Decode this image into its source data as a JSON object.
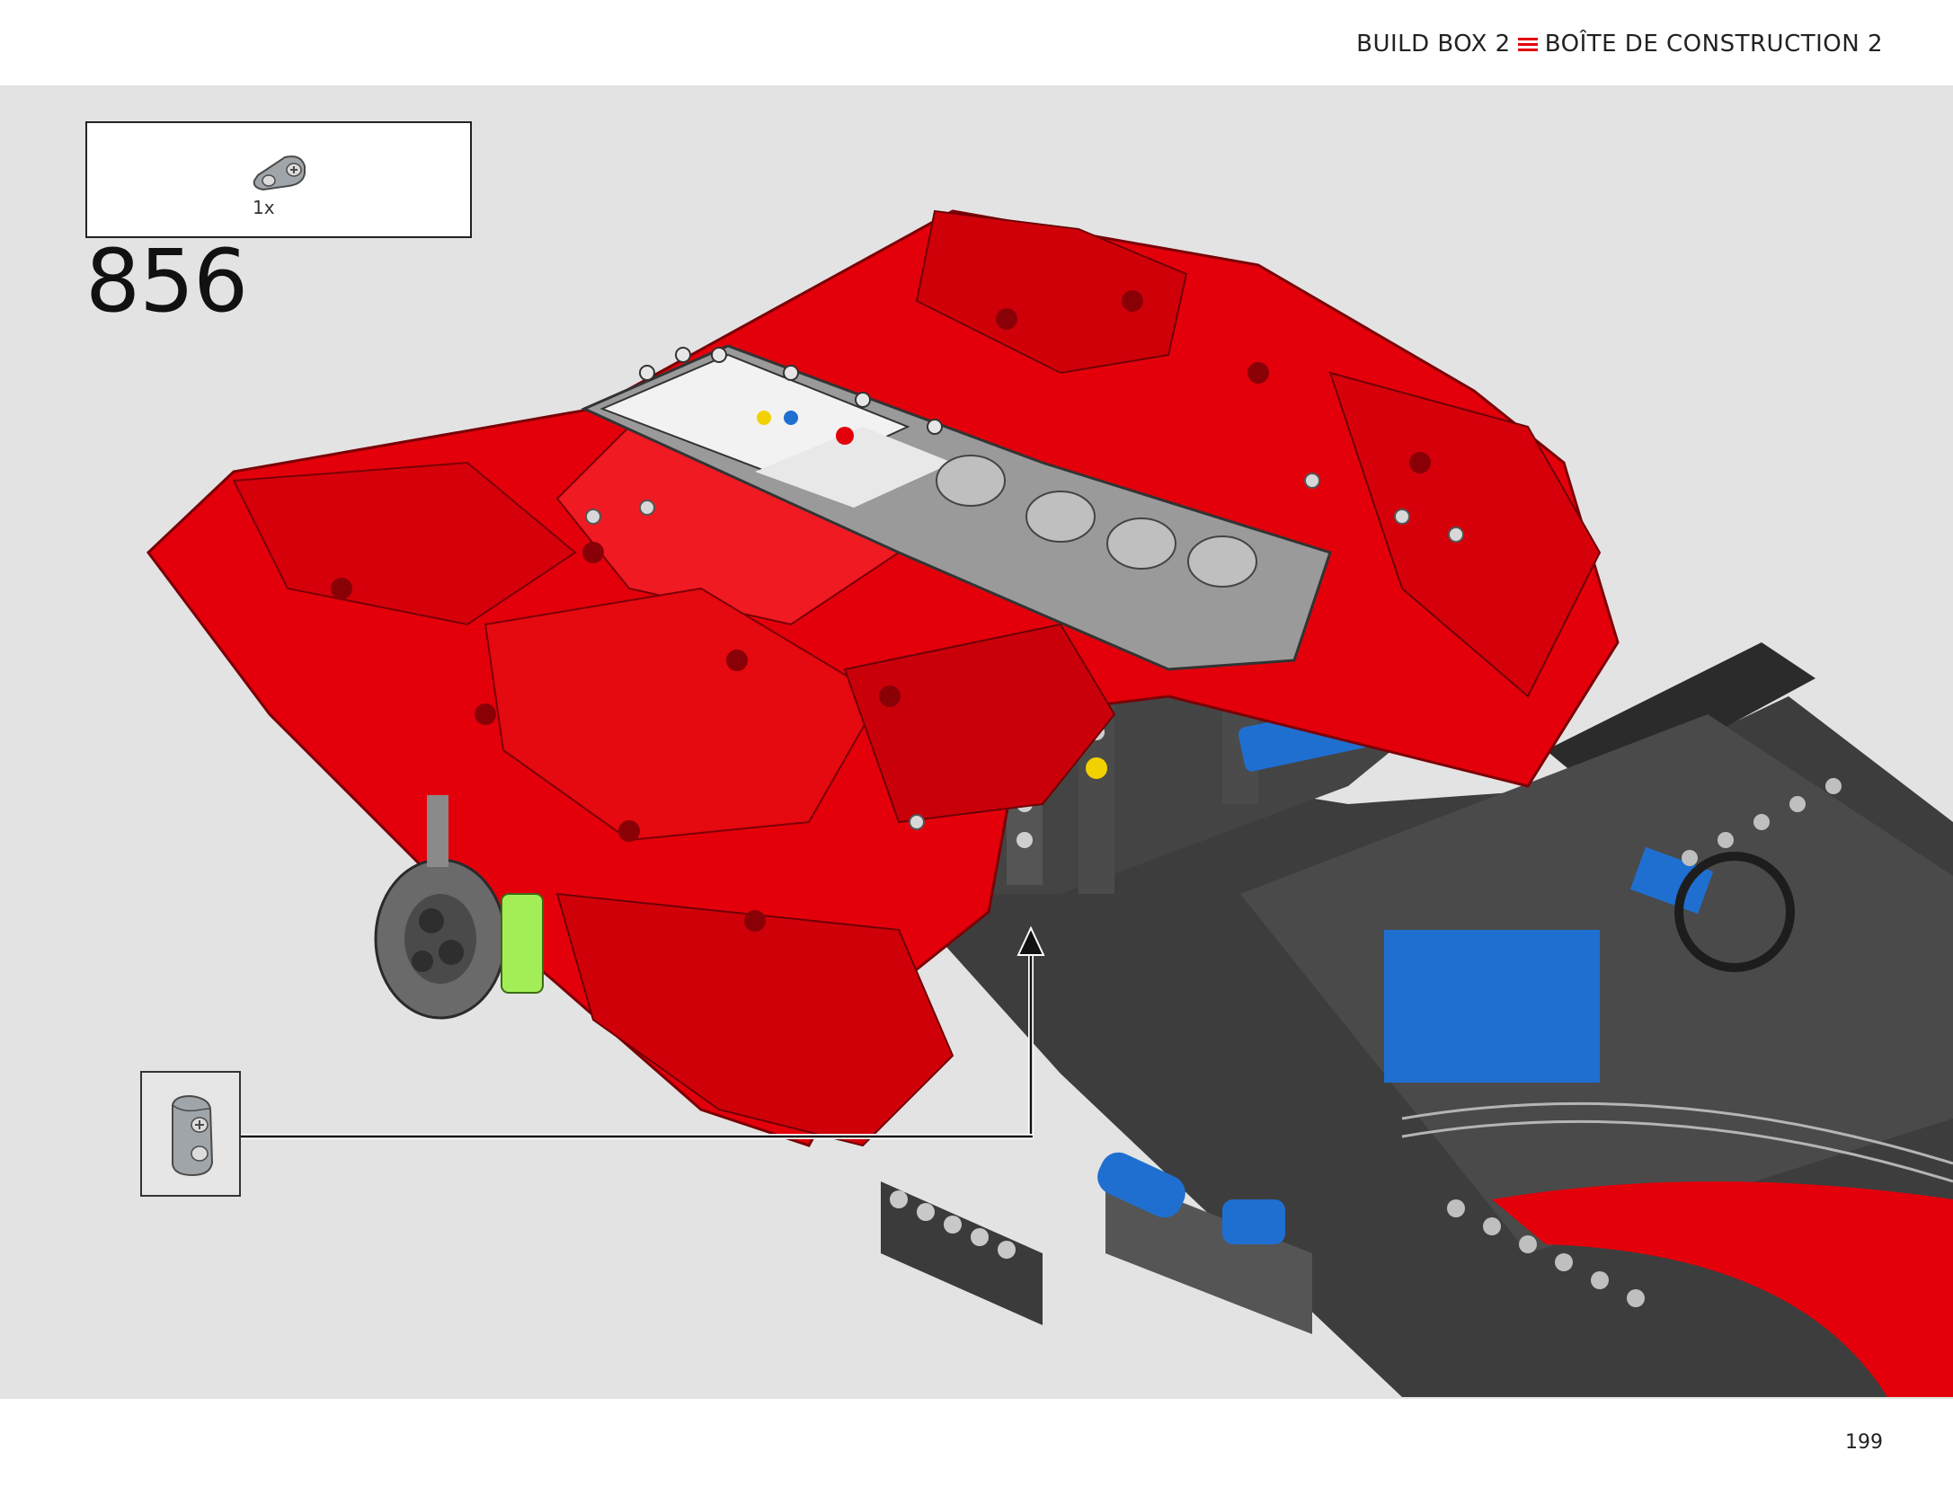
{
  "header": {
    "left_label": "BUILD BOX 2",
    "right_label": "BOÎTE DE CONSTRUCTION 2",
    "separator_icon": "triple-bar-icon",
    "accent_color": "#e3000b"
  },
  "step": {
    "number": "856",
    "parts": [
      {
        "quantity": "1x",
        "icon": "light-gray-2l-beam-icon",
        "color": "#a0a5a9"
      }
    ]
  },
  "callout": {
    "icon": "light-gray-2l-beam-icon"
  },
  "colors": {
    "background": "#e3e3e3",
    "body_red": "#e3000b",
    "frame_dark": "#3a3a3a",
    "accent_blue": "#1f6fd1",
    "beam_gray": "#a0a5a9"
  },
  "footer": {
    "page_number": "199"
  }
}
